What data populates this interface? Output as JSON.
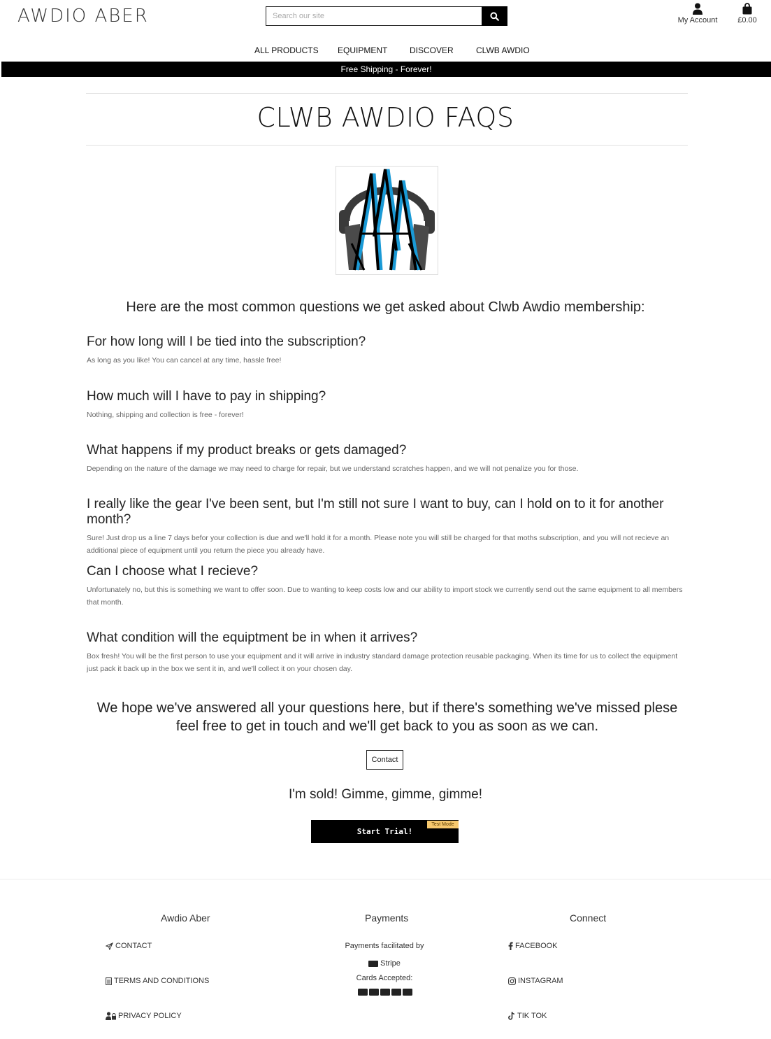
{
  "header": {
    "logo_text": "AWDIO ABER",
    "search_placeholder": "Search our site",
    "account_label": "My Account",
    "cart_total": "£0.00"
  },
  "nav": {
    "items": [
      "ALL PRODUCTS",
      "EQUIPMENT",
      "DISCOVER",
      "CLWB AWDIO"
    ]
  },
  "banner": {
    "text": "Free Shipping - Forever!"
  },
  "page": {
    "title": "CLWB AWDIO FAQS",
    "intro": "Here are the most common questions we get asked about Clwb Awdio membership:",
    "faqs": [
      {
        "question": "For how long will I be tied into the subscription?",
        "answer": "As long as you like! You can cancel at any time, hassle free!"
      },
      {
        "question": "How much will I have to pay in shipping?",
        "answer": "Nothing, shipping and collection is free - forever!"
      },
      {
        "question": "What happens if my product breaks or gets damaged?",
        "answer": "Depending on the nature of the damage we may need to charge for repair, but we understand scratches happen, and we will not penalize you for those."
      },
      {
        "question": "I really like the gear I've been sent, but I'm still not sure I want to buy, can I hold on to it for another month?",
        "answer": "Sure! Just drop us a line 7 days befor your collection is due and we'll hold it for a month. Please note you will still be charged for that moths subscription, and you will not recieve an additional piece of equipment until you return the piece you already have."
      },
      {
        "question": "Can I choose what I recieve?",
        "answer": "Unfortunately no, but this is something we want to offer soon. Due to wanting to keep costs low and our ability to import stock we currently send out the same equipment to all members that month."
      },
      {
        "question": "What condition will the equiptment be in when it arrives?",
        "answer": "Box fresh! You will be the first person to use your equipment and it will arrive in industry standard damage protection reusable packaging. When its time for us to collect the equipment just pack it back up in the box we sent it in, and we'll collect it on your chosen day."
      }
    ],
    "closing": "We hope we've answered all your questions here, but if there's something we've missed plese feel free to get in touch and we'll get back to you as soon as we can.",
    "contact_button": "Contact",
    "sold_text": "I'm sold! Gimme, gimme, gimme!",
    "trial_button": "Start Trial!",
    "test_mode_badge": "Test Mode"
  },
  "footer": {
    "col1_title": "Awdio Aber",
    "col1_links": [
      "CONTACT",
      "TERMS AND CONDITIONS",
      "PRIVACY POLICY"
    ],
    "col2_title": "Payments",
    "payments_facilitated": "Payments facilitated by",
    "stripe_label": "Stripe",
    "cards_accepted": "Cards Accepted:",
    "col3_title": "Connect",
    "col3_links": [
      "FACEBOOK",
      "INSTAGRAM",
      "TIK TOK"
    ]
  },
  "colors": {
    "accent_blue": "#1a9ad6",
    "black": "#000000",
    "test_mode_bg": "#f7c96e"
  }
}
